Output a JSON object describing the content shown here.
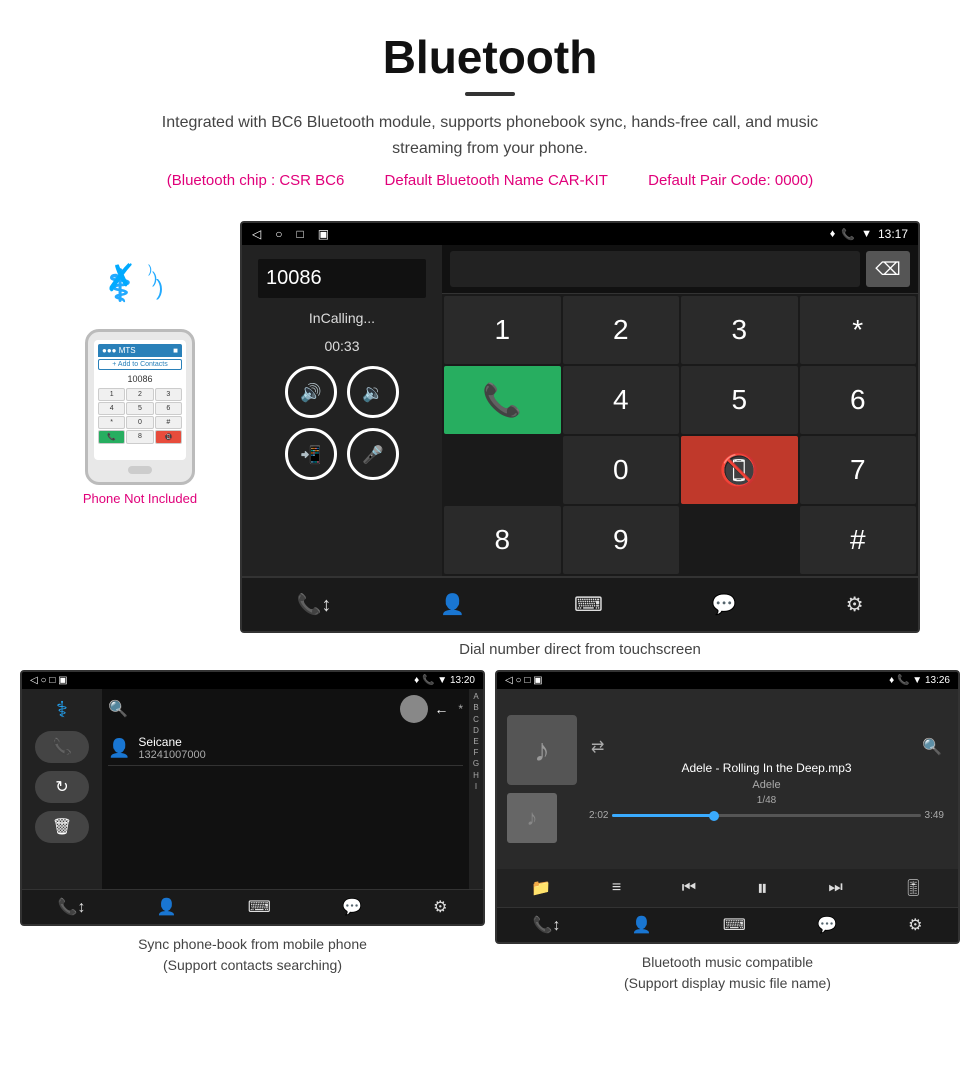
{
  "header": {
    "title": "Bluetooth",
    "description": "Integrated with BC6 Bluetooth module, supports phonebook sync, hands-free call, and music streaming from your phone.",
    "spec1": "(Bluetooth chip : CSR BC6",
    "spec2": "Default Bluetooth Name CAR-KIT",
    "spec3": "Default Pair Code: 0000)",
    "phone_label": "Phone Not Included"
  },
  "dial_screen": {
    "status_left": [
      "◁",
      "○",
      "□",
      "▣"
    ],
    "status_right": [
      "♦",
      "📞",
      "▼",
      "13:17"
    ],
    "dial_number": "10086",
    "calling_status": "InCalling...",
    "calling_time": "00:33",
    "keypad_keys": [
      "1",
      "2",
      "3",
      "*",
      "4",
      "5",
      "6",
      "0",
      "7",
      "8",
      "9",
      "#"
    ],
    "caption": "Dial number direct from touchscreen"
  },
  "phonebook_screen": {
    "status_time": "13:20",
    "contact_name": "Seicane",
    "contact_number": "13241007000",
    "alphabet": [
      "A",
      "B",
      "C",
      "D",
      "E",
      "F",
      "G",
      "H",
      "I"
    ],
    "caption_line1": "Sync phone-book from mobile phone",
    "caption_line2": "(Support contacts searching)"
  },
  "music_screen": {
    "status_time": "13:26",
    "song_title": "Adele - Rolling In the Deep.mp3",
    "artist": "Adele",
    "track_count": "1/48",
    "time_current": "2:02",
    "time_total": "3:49",
    "progress_percent": 33,
    "caption_line1": "Bluetooth music compatible",
    "caption_line2": "(Support display music file name)"
  }
}
